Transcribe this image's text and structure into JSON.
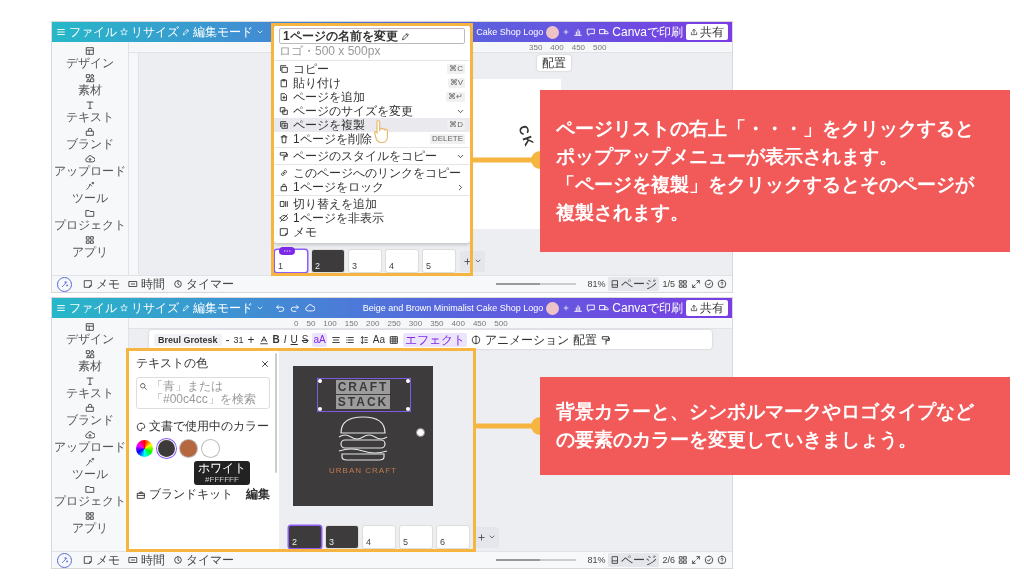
{
  "screens": [
    {
      "kind": "page-menu",
      "topbar": {
        "menu": [
          "ファイル",
          "リサイズ",
          "編集モード"
        ],
        "title": "Cake Shop Logo",
        "print": "Canvaで印刷",
        "share": "共有"
      },
      "sidebar": [
        "デザイン",
        "素材",
        "テキスト",
        "ブランド",
        "アップロード",
        "ツール",
        "プロジェクト",
        "アプリ"
      ],
      "ruler": [
        "350",
        "400",
        "450",
        "500"
      ],
      "toolbar": {
        "position": "配置"
      },
      "canvas": {
        "text": "CK"
      },
      "menu": {
        "title": "1ページの名前を変更",
        "subtitle": "ロゴ・500 x 500px",
        "groups": [
          [
            {
              "label": "コピー",
              "shortcut": "⌘C",
              "expandable": false,
              "has_submenu": false,
              "selected": false
            },
            {
              "label": "貼り付け",
              "shortcut": "⌘V",
              "expandable": false,
              "has_submenu": false,
              "selected": false
            },
            {
              "label": "ページを追加",
              "shortcut": "⌘↵",
              "expandable": false,
              "has_submenu": false,
              "selected": false
            },
            {
              "label": "ページのサイズを変更",
              "expandable": true,
              "has_submenu": false,
              "selected": false
            },
            {
              "label": "ページを複製",
              "shortcut": "⌘D",
              "expandable": false,
              "has_submenu": false,
              "selected": true
            },
            {
              "label": "1ページを削除",
              "shortcut": "DELETE",
              "expandable": false,
              "has_submenu": false,
              "selected": false
            }
          ],
          [
            {
              "label": "ページのスタイルをコピー",
              "expandable": true,
              "has_submenu": false,
              "selected": false
            }
          ],
          [
            {
              "label": "このページへのリンクをコピー",
              "expandable": false,
              "has_submenu": false,
              "selected": false
            },
            {
              "label": "1ページをロック",
              "expandable": false,
              "has_submenu": true,
              "selected": false
            }
          ],
          [
            {
              "label": "切り替えを追加",
              "expandable": false,
              "has_submenu": false,
              "selected": false
            },
            {
              "label": "1ページを非表示",
              "expandable": false,
              "has_submenu": false,
              "selected": false
            },
            {
              "label": "メモ",
              "expandable": false,
              "has_submenu": false,
              "selected": false
            }
          ]
        ]
      },
      "pages": [
        {
          "label": "1",
          "kind": "light",
          "selected": true
        },
        {
          "label": "2",
          "kind": "dark",
          "selected": false
        },
        {
          "label": "3",
          "kind": "light",
          "selected": false
        },
        {
          "label": "4",
          "kind": "light",
          "selected": false
        },
        {
          "label": "5",
          "kind": "light",
          "selected": false
        }
      ],
      "bottom_bar": {
        "notes": "メモ",
        "duration": "時間",
        "timer": "タイマー",
        "zoom_slider": {
          "level": 0.55
        },
        "zoom": "81%",
        "pages": "ページ",
        "page_count": "1/5"
      },
      "callout": {
        "lines": [
          "ページリストの右上「・・・」をクリックすると",
          "ポップアップメニューが表示されます。",
          "「ページを複製」をクリックするとそのページが",
          "複製されます。"
        ]
      }
    },
    {
      "kind": "color-panel",
      "topbar": {
        "menu": [
          "ファイル",
          "リサイズ",
          "編集モード"
        ],
        "history": true,
        "title": "Beige and Brown Minimalist Cake Shop Logo",
        "print": "Canvaで印刷",
        "share": "共有"
      },
      "sidebar": [
        "デザイン",
        "素材",
        "テキスト",
        "ブランド",
        "アップロード",
        "ツール",
        "プロジェクト",
        "アプリ"
      ],
      "ruler": [
        "0",
        "50",
        "100",
        "150",
        "200",
        "250",
        "300",
        "350",
        "400",
        "450",
        "500"
      ],
      "toolbar": {
        "font": "Breul Grotesk",
        "decrease": "-",
        "size": "31",
        "increase": "+",
        "format": [
          {
            "label": "B",
            "selected": false
          },
          {
            "label": "I",
            "selected": false
          },
          {
            "label": "U",
            "selected": false
          },
          {
            "label": "S",
            "selected": false
          },
          {
            "label": "aA",
            "selected": true
          }
        ],
        "case": "Aa",
        "effects": "エフェクト",
        "animate": "アニメーション",
        "position": "配置"
      },
      "panel": {
        "title": "テキストの色",
        "search_placeholder": "「青」または「#00c4cc」を検索",
        "section": "文書で使用中のカラー",
        "swatches": [
          {
            "color": "#3d3a3a",
            "selected": true
          },
          {
            "color": "#b5673f",
            "selected": false
          },
          {
            "color": "#ffffff",
            "selected": false
          }
        ],
        "tooltip": {
          "name": "ホワイト",
          "code": "#FFFFFF"
        },
        "brand_kit": "ブランドキット",
        "edit": "編集"
      },
      "canvas": {
        "lines": [
          "CRAFT",
          "STACK"
        ],
        "tagline": "URBAN CRAFT"
      },
      "pages": [
        {
          "label": "2",
          "kind": "dark",
          "selected": true
        },
        {
          "label": "3",
          "kind": "dark",
          "selected": false
        },
        {
          "label": "4",
          "kind": "light",
          "selected": false
        },
        {
          "label": "5",
          "kind": "light",
          "selected": false
        },
        {
          "label": "6",
          "kind": "light",
          "selected": false
        }
      ],
      "bottom_bar": {
        "notes": "メモ",
        "duration": "時間",
        "timer": "タイマー",
        "zoom_slider": {
          "level": 0.55
        },
        "zoom": "81%",
        "pages": "ページ",
        "page_count": "2/6"
      },
      "callout": {
        "lines": [
          "背景カラーと、シンボルマークやロゴタイプなど",
          "の要素のカラーを変更していきましょう。"
        ]
      }
    }
  ]
}
